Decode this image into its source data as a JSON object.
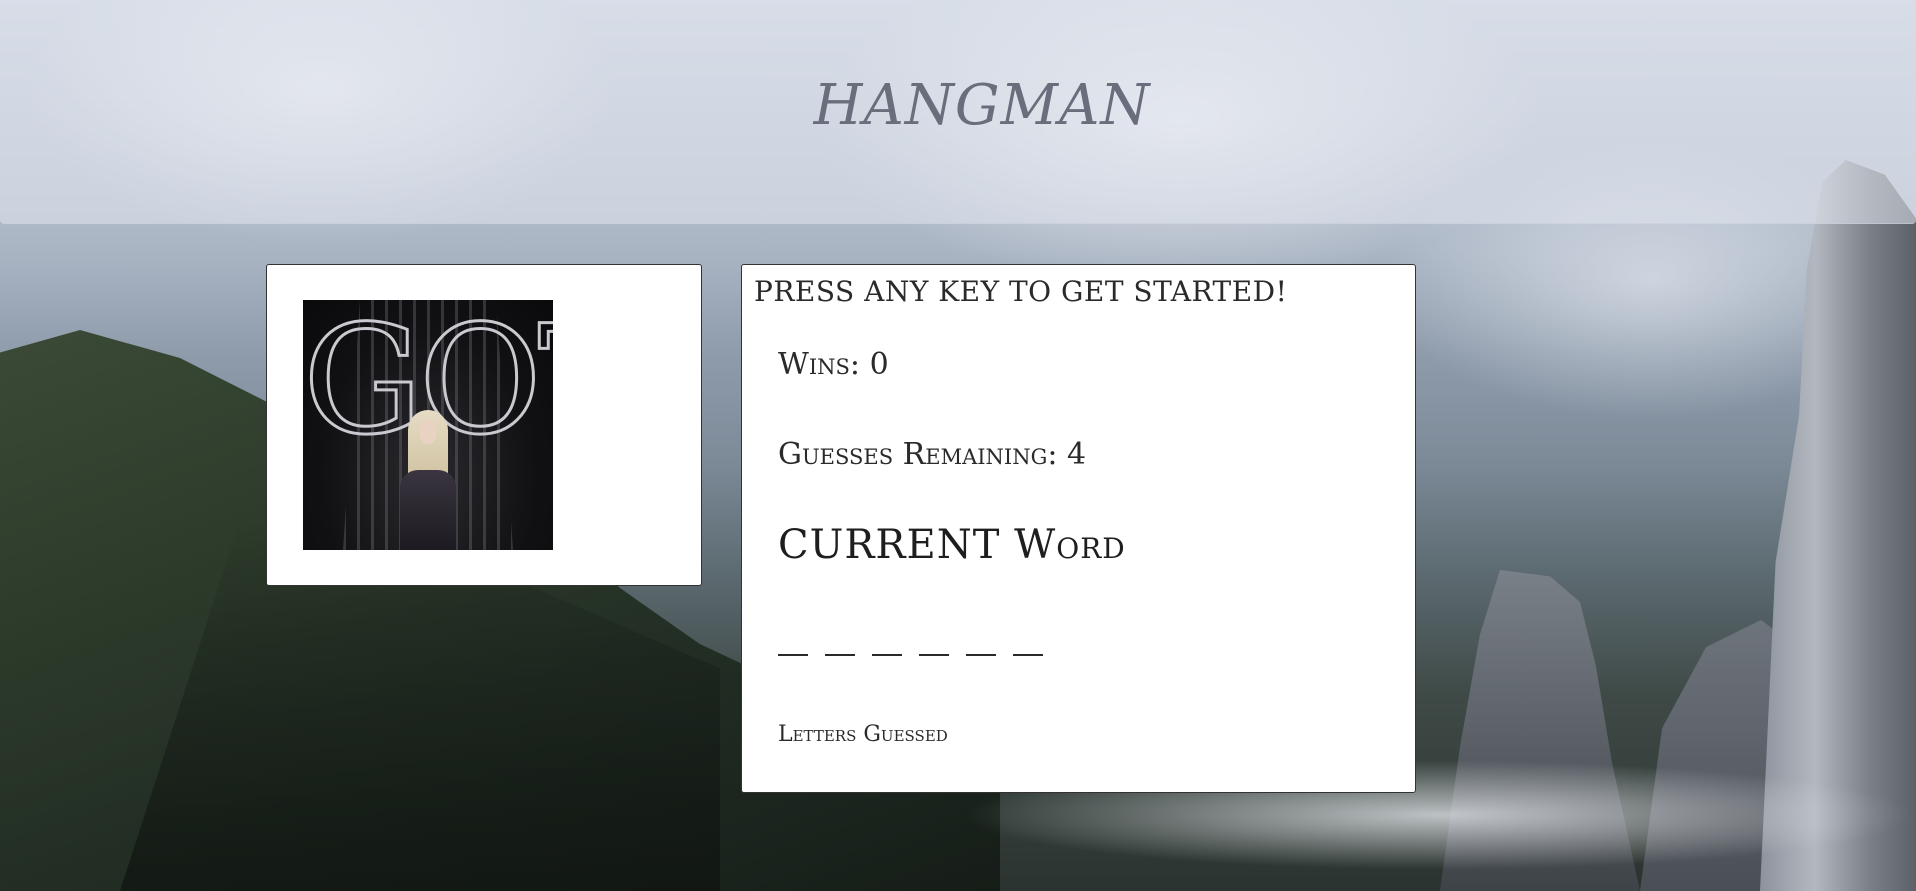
{
  "header": {
    "title": "HANGMAN"
  },
  "poster": {
    "letters": "GOT",
    "icon": "game-of-thrones-poster"
  },
  "game": {
    "prompt": "PRESS ANY KEY TO GET STARTED!",
    "wins_label": "Wins",
    "wins_value": "0",
    "guesses_label": "Guesses Remaining",
    "guesses_value": "4",
    "current_word_heading": "CURRENT Word",
    "current_word_blanks": [
      "",
      "",
      "",
      "",
      "",
      ""
    ],
    "letters_guessed_label": "Letters Guessed",
    "letters_guessed": ""
  },
  "colors": {
    "header_overlay": "#e4e8f0",
    "title_color": "#6a6e7c",
    "panel_background": "#ffffff",
    "panel_border": "#333333",
    "text": "#2a2a2a"
  }
}
